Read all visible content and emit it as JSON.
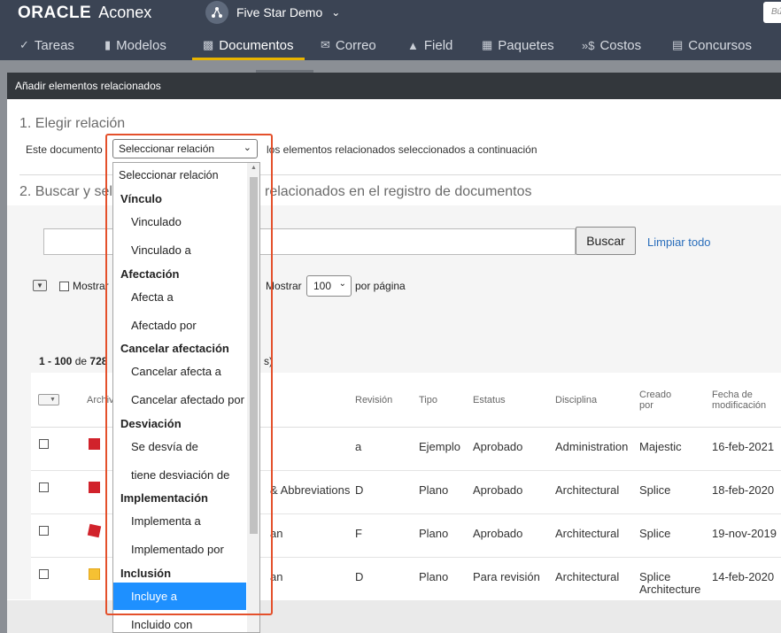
{
  "header": {
    "brand_oracle": "ORACLE",
    "brand_product": "Aconex",
    "project_name": "Five Star Demo",
    "search_placeholder": "Bú"
  },
  "nav": {
    "items": [
      {
        "label": "Tareas",
        "icon": "check-icon"
      },
      {
        "label": "Modelos",
        "icon": "cube-icon"
      },
      {
        "label": "Documentos",
        "icon": "document-icon",
        "active": true
      },
      {
        "label": "Correo",
        "icon": "mail-icon"
      },
      {
        "label": "Field",
        "icon": "warning-icon"
      },
      {
        "label": "Paquetes",
        "icon": "packages-icon"
      },
      {
        "label": "Costos",
        "icon": "costs-icon"
      },
      {
        "label": "Concursos",
        "icon": "tender-icon"
      }
    ]
  },
  "dialog": {
    "title": "Añadir elementos relacionados",
    "step1_title": "1. Elegir relación",
    "relation_label": "Este documento",
    "relation_selected": "Seleccionar relación",
    "relation_suffix": "los elementos relacionados seleccionados a continuación",
    "step2_title": "2. Buscar y sel",
    "step2_tail": "relacionados en el registro de documentos",
    "search_button": "Buscar",
    "clear_link": "Limpiar todo",
    "show_label": "Mostrar",
    "show_label2": "Mostrar",
    "per_page_value": "100",
    "per_page_suffix": "por página",
    "count_prefix": "1 - 100",
    "count_of": "de",
    "count_total": "728",
    "count_tail": "s)"
  },
  "table": {
    "headers": {
      "archivo": "Archiv",
      "revision": "Revisión",
      "tipo": "Tipo",
      "estatus": "Estatus",
      "disciplina": "Disciplina",
      "creado_por": "Creado por",
      "fecha": "Fecha de modificación"
    },
    "rows": [
      {
        "title_fragment": "",
        "revision": "a",
        "tipo": "Ejemplo",
        "estatus": "Aprobado",
        "disciplina": "Administration",
        "creado": "Majestic",
        "fecha": "16-feb-2021",
        "icon": "pdf-icon"
      },
      {
        "title_fragment": "& Abbreviations",
        "revision": "D",
        "tipo": "Plano",
        "estatus": "Aprobado",
        "disciplina": "Architectural",
        "creado": "Splice",
        "fecha": "18-feb-2020",
        "icon": "pdf-icon"
      },
      {
        "title_fragment": "an",
        "revision": "F",
        "tipo": "Plano",
        "estatus": "Aprobado",
        "disciplina": "Architectural",
        "creado": "Splice",
        "fecha": "19-nov-2019",
        "icon": "pdf-markup-icon"
      },
      {
        "title_fragment": "an",
        "revision": "D",
        "tipo": "Plano",
        "estatus": "Para revisión",
        "disciplina": "Architectural",
        "creado": "Splice Architecture",
        "fecha": "14-feb-2020",
        "icon": "image-icon"
      }
    ]
  },
  "dropdown": {
    "options": [
      {
        "kind": "first",
        "label": "Seleccionar relación"
      },
      {
        "kind": "group",
        "label": "Vínculo"
      },
      {
        "kind": "item",
        "label": "Vinculado"
      },
      {
        "kind": "item",
        "label": "Vinculado a"
      },
      {
        "kind": "group",
        "label": "Afectación"
      },
      {
        "kind": "item",
        "label": "Afecta a"
      },
      {
        "kind": "item",
        "label": "Afectado por"
      },
      {
        "kind": "group",
        "label": "Cancelar afectación"
      },
      {
        "kind": "item",
        "label": "Cancelar afecta a"
      },
      {
        "kind": "item",
        "label": "Cancelar afectado por"
      },
      {
        "kind": "group",
        "label": "Desviación"
      },
      {
        "kind": "item",
        "label": "Se desvía de"
      },
      {
        "kind": "item",
        "label": "tiene desviación de"
      },
      {
        "kind": "group",
        "label": "Implementación"
      },
      {
        "kind": "item",
        "label": "Implementa a"
      },
      {
        "kind": "item",
        "label": "Implementado por"
      },
      {
        "kind": "group",
        "label": "Inclusión"
      },
      {
        "kind": "selected",
        "label": "Incluye a"
      },
      {
        "kind": "item",
        "label": "Incluido con"
      }
    ]
  },
  "colors": {
    "topbar": "#3b4454",
    "active_underline": "#e8b400",
    "highlight": "#e4502b",
    "selected_option": "#1e90ff",
    "link": "#2a6ebb"
  }
}
